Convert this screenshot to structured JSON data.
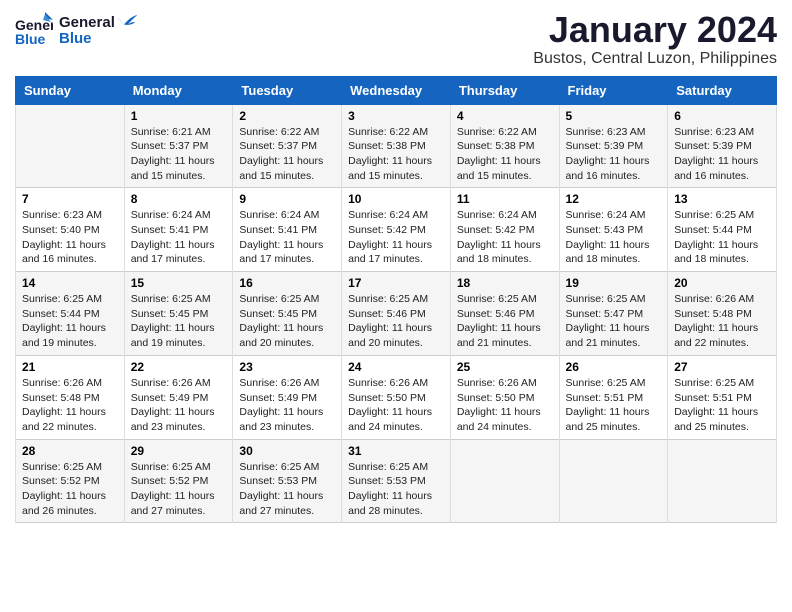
{
  "logo": {
    "line1": "General",
    "line2": "Blue"
  },
  "title": "January 2024",
  "location": "Bustos, Central Luzon, Philippines",
  "days_of_week": [
    "Sunday",
    "Monday",
    "Tuesday",
    "Wednesday",
    "Thursday",
    "Friday",
    "Saturday"
  ],
  "weeks": [
    [
      {
        "day": "",
        "content": ""
      },
      {
        "day": "1",
        "content": "Sunrise: 6:21 AM\nSunset: 5:37 PM\nDaylight: 11 hours\nand 15 minutes."
      },
      {
        "day": "2",
        "content": "Sunrise: 6:22 AM\nSunset: 5:37 PM\nDaylight: 11 hours\nand 15 minutes."
      },
      {
        "day": "3",
        "content": "Sunrise: 6:22 AM\nSunset: 5:38 PM\nDaylight: 11 hours\nand 15 minutes."
      },
      {
        "day": "4",
        "content": "Sunrise: 6:22 AM\nSunset: 5:38 PM\nDaylight: 11 hours\nand 15 minutes."
      },
      {
        "day": "5",
        "content": "Sunrise: 6:23 AM\nSunset: 5:39 PM\nDaylight: 11 hours\nand 16 minutes."
      },
      {
        "day": "6",
        "content": "Sunrise: 6:23 AM\nSunset: 5:39 PM\nDaylight: 11 hours\nand 16 minutes."
      }
    ],
    [
      {
        "day": "7",
        "content": "Sunrise: 6:23 AM\nSunset: 5:40 PM\nDaylight: 11 hours\nand 16 minutes."
      },
      {
        "day": "8",
        "content": "Sunrise: 6:24 AM\nSunset: 5:41 PM\nDaylight: 11 hours\nand 17 minutes."
      },
      {
        "day": "9",
        "content": "Sunrise: 6:24 AM\nSunset: 5:41 PM\nDaylight: 11 hours\nand 17 minutes."
      },
      {
        "day": "10",
        "content": "Sunrise: 6:24 AM\nSunset: 5:42 PM\nDaylight: 11 hours\nand 17 minutes."
      },
      {
        "day": "11",
        "content": "Sunrise: 6:24 AM\nSunset: 5:42 PM\nDaylight: 11 hours\nand 18 minutes."
      },
      {
        "day": "12",
        "content": "Sunrise: 6:24 AM\nSunset: 5:43 PM\nDaylight: 11 hours\nand 18 minutes."
      },
      {
        "day": "13",
        "content": "Sunrise: 6:25 AM\nSunset: 5:44 PM\nDaylight: 11 hours\nand 18 minutes."
      }
    ],
    [
      {
        "day": "14",
        "content": "Sunrise: 6:25 AM\nSunset: 5:44 PM\nDaylight: 11 hours\nand 19 minutes."
      },
      {
        "day": "15",
        "content": "Sunrise: 6:25 AM\nSunset: 5:45 PM\nDaylight: 11 hours\nand 19 minutes."
      },
      {
        "day": "16",
        "content": "Sunrise: 6:25 AM\nSunset: 5:45 PM\nDaylight: 11 hours\nand 20 minutes."
      },
      {
        "day": "17",
        "content": "Sunrise: 6:25 AM\nSunset: 5:46 PM\nDaylight: 11 hours\nand 20 minutes."
      },
      {
        "day": "18",
        "content": "Sunrise: 6:25 AM\nSunset: 5:46 PM\nDaylight: 11 hours\nand 21 minutes."
      },
      {
        "day": "19",
        "content": "Sunrise: 6:25 AM\nSunset: 5:47 PM\nDaylight: 11 hours\nand 21 minutes."
      },
      {
        "day": "20",
        "content": "Sunrise: 6:26 AM\nSunset: 5:48 PM\nDaylight: 11 hours\nand 22 minutes."
      }
    ],
    [
      {
        "day": "21",
        "content": "Sunrise: 6:26 AM\nSunset: 5:48 PM\nDaylight: 11 hours\nand 22 minutes."
      },
      {
        "day": "22",
        "content": "Sunrise: 6:26 AM\nSunset: 5:49 PM\nDaylight: 11 hours\nand 23 minutes."
      },
      {
        "day": "23",
        "content": "Sunrise: 6:26 AM\nSunset: 5:49 PM\nDaylight: 11 hours\nand 23 minutes."
      },
      {
        "day": "24",
        "content": "Sunrise: 6:26 AM\nSunset: 5:50 PM\nDaylight: 11 hours\nand 24 minutes."
      },
      {
        "day": "25",
        "content": "Sunrise: 6:26 AM\nSunset: 5:50 PM\nDaylight: 11 hours\nand 24 minutes."
      },
      {
        "day": "26",
        "content": "Sunrise: 6:25 AM\nSunset: 5:51 PM\nDaylight: 11 hours\nand 25 minutes."
      },
      {
        "day": "27",
        "content": "Sunrise: 6:25 AM\nSunset: 5:51 PM\nDaylight: 11 hours\nand 25 minutes."
      }
    ],
    [
      {
        "day": "28",
        "content": "Sunrise: 6:25 AM\nSunset: 5:52 PM\nDaylight: 11 hours\nand 26 minutes."
      },
      {
        "day": "29",
        "content": "Sunrise: 6:25 AM\nSunset: 5:52 PM\nDaylight: 11 hours\nand 27 minutes."
      },
      {
        "day": "30",
        "content": "Sunrise: 6:25 AM\nSunset: 5:53 PM\nDaylight: 11 hours\nand 27 minutes."
      },
      {
        "day": "31",
        "content": "Sunrise: 6:25 AM\nSunset: 5:53 PM\nDaylight: 11 hours\nand 28 minutes."
      },
      {
        "day": "",
        "content": ""
      },
      {
        "day": "",
        "content": ""
      },
      {
        "day": "",
        "content": ""
      }
    ]
  ]
}
